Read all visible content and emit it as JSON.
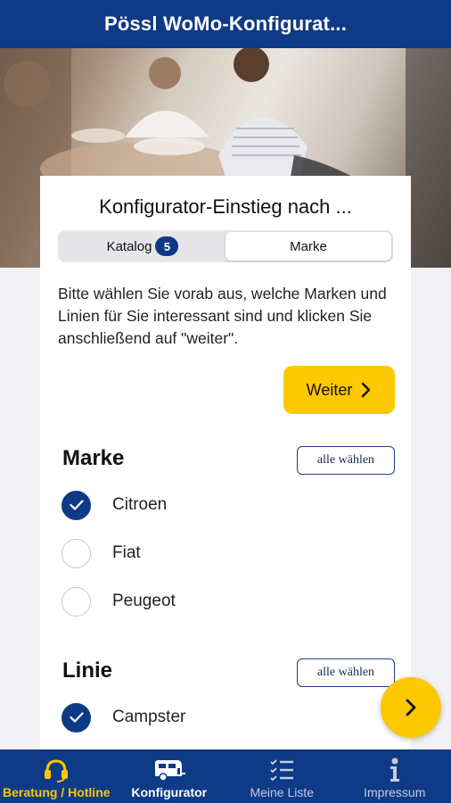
{
  "header": {
    "title": "Pössl WoMo-Konfigurat..."
  },
  "card": {
    "title": "Konfigurator-Einstieg nach ...",
    "segments": [
      {
        "label": "Katalog",
        "badge": "5",
        "active": false
      },
      {
        "label": "Marke",
        "active": true
      }
    ],
    "intro": "Bitte wählen Sie vorab aus, welche Marken und Linien für Sie interessant sind und klicken Sie anschließend auf \"weiter\".",
    "weiter_label": "Weiter"
  },
  "marke": {
    "title": "Marke",
    "select_all": "alle wählen",
    "options": [
      {
        "label": "Citroen",
        "checked": true
      },
      {
        "label": "Fiat",
        "checked": false
      },
      {
        "label": "Peugeot",
        "checked": false
      }
    ]
  },
  "linie": {
    "title": "Linie",
    "select_all": "alle wählen",
    "options": [
      {
        "label": "Campster",
        "checked": true
      }
    ]
  },
  "tabbar": {
    "items": [
      {
        "label": "Beratung / Hotline",
        "icon": "headset-icon"
      },
      {
        "label": "Konfigurator",
        "icon": "caravan-icon"
      },
      {
        "label": "Meine Liste",
        "icon": "checklist-icon"
      },
      {
        "label": "Impressum",
        "icon": "info-icon"
      }
    ]
  },
  "colors": {
    "primary": "#0f3a86",
    "accent": "#fcc800"
  }
}
